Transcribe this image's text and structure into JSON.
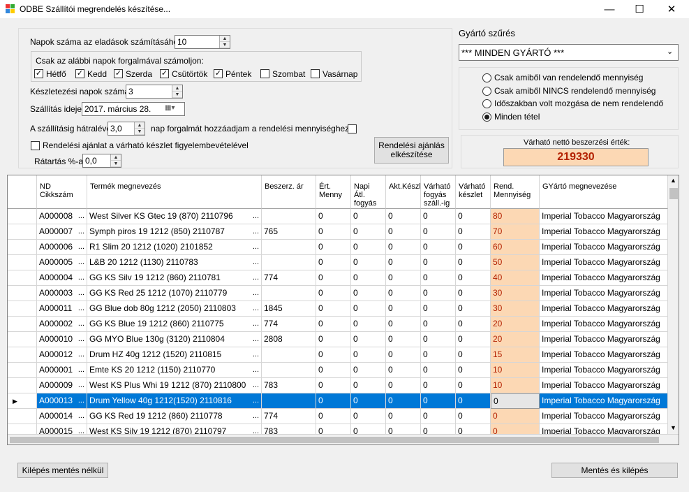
{
  "window": {
    "title": "ODBE Szállítói megrendelés készítése...",
    "minimize": "—",
    "maximize": "☐",
    "close": "✕"
  },
  "settings": {
    "days_label": "Napok száma az eladások számításához:",
    "days_value": "10",
    "weekdays_group_label": "Csak az alábbi napok forgalmával számoljon:",
    "weekdays": [
      {
        "label": "Hétfő",
        "checked": true
      },
      {
        "label": "Kedd",
        "checked": true
      },
      {
        "label": "Szerda",
        "checked": true
      },
      {
        "label": "Csütörtök",
        "checked": true
      },
      {
        "label": "Péntek",
        "checked": true
      },
      {
        "label": "Szombat",
        "checked": false
      },
      {
        "label": "Vasárnap",
        "checked": false
      }
    ],
    "stock_days_label": "Készletezési napok száma",
    "stock_days_value": "3",
    "delivery_label": "Szállítás ideje:",
    "delivery_date": "2017.   március   28.",
    "remaining_label": "A szállításig hátralévő",
    "remaining_value": "3,0",
    "remaining_suffix": "nap forgalmát hozzáadjam a rendelési mennyiséghez?",
    "consider_stock_label": "Rendelési ajánlat a várható készlet figyelembevételével",
    "margin_label": "Rátartás %-a",
    "margin_value": "0,0",
    "make_offer_button": "Rendelési ajánlás elkészítése"
  },
  "filter": {
    "title": "Gyártó szűrés",
    "manufacturer_selected": "*** MINDEN GYÁRTÓ ***",
    "options": [
      {
        "label": "Csak amiből van rendelendő mennyiség",
        "selected": false
      },
      {
        "label": "Csak amiből NINCS rendelendő mennyiség",
        "selected": false
      },
      {
        "label": "Időszakban volt mozgása de nem rendelendő",
        "selected": false
      },
      {
        "label": "Minden tétel",
        "selected": true
      }
    ],
    "expected_value_label": "Várható nettó beszerzési érték:",
    "expected_value": "219330"
  },
  "grid": {
    "headers": {
      "code": "ND Cikkszám",
      "name": "Termék megnevezés",
      "price": "Beszerz. ár",
      "sales": "Ért. Menny",
      "daily": "Napi Átl. fogyás",
      "stock": "Akt.Készl",
      "exp_sales": "Várható fogyás száll.-ig",
      "exp_stock": "Várható készlet",
      "order": "Rend. Mennyiség",
      "manufacturer": "GYártó megnevezése"
    },
    "rows": [
      {
        "code": "A000008",
        "name": "West Silver KS Gtec 19 (870) 2110796",
        "price": "",
        "sales": "0",
        "daily": "0",
        "stock": "0",
        "exp_sales": "0",
        "exp_stock": "0",
        "order": "80",
        "manufacturer": "Imperial Tobacco Magyarország"
      },
      {
        "code": "A000007",
        "name": "Symph piros 19 1212 (850) 2110787",
        "price": "765",
        "sales": "0",
        "daily": "0",
        "stock": "0",
        "exp_sales": "0",
        "exp_stock": "0",
        "order": "70",
        "manufacturer": "Imperial Tobacco Magyarország"
      },
      {
        "code": "A000006",
        "name": "R1 Slim 20 1212 (1020) 2101852",
        "price": "",
        "sales": "0",
        "daily": "0",
        "stock": "0",
        "exp_sales": "0",
        "exp_stock": "0",
        "order": "60",
        "manufacturer": "Imperial Tobacco Magyarország"
      },
      {
        "code": "A000005",
        "name": "L&B 20 1212 (1130) 2110783",
        "price": "",
        "sales": "0",
        "daily": "0",
        "stock": "0",
        "exp_sales": "0",
        "exp_stock": "0",
        "order": "50",
        "manufacturer": "Imperial Tobacco Magyarország"
      },
      {
        "code": "A000004",
        "name": "GG KS Silv 19 1212 (860) 2110781",
        "price": "774",
        "sales": "0",
        "daily": "0",
        "stock": "0",
        "exp_sales": "0",
        "exp_stock": "0",
        "order": "40",
        "manufacturer": "Imperial Tobacco Magyarország"
      },
      {
        "code": "A000003",
        "name": "GG KS Red 25 1212 (1070) 2110779",
        "price": "",
        "sales": "0",
        "daily": "0",
        "stock": "0",
        "exp_sales": "0",
        "exp_stock": "0",
        "order": "30",
        "manufacturer": "Imperial Tobacco Magyarország"
      },
      {
        "code": "A000011",
        "name": "GG Blue dob 80g 1212 (2050) 2110803",
        "price": "1845",
        "sales": "0",
        "daily": "0",
        "stock": "0",
        "exp_sales": "0",
        "exp_stock": "0",
        "order": "30",
        "manufacturer": "Imperial Tobacco Magyarország"
      },
      {
        "code": "A000002",
        "name": "GG KS Blue 19 1212 (860) 2110775",
        "price": "774",
        "sales": "0",
        "daily": "0",
        "stock": "0",
        "exp_sales": "0",
        "exp_stock": "0",
        "order": "20",
        "manufacturer": "Imperial Tobacco Magyarország"
      },
      {
        "code": "A000010",
        "name": "GG MYO Blue 130g (3120) 2110804",
        "price": "2808",
        "sales": "0",
        "daily": "0",
        "stock": "0",
        "exp_sales": "0",
        "exp_stock": "0",
        "order": "20",
        "manufacturer": "Imperial Tobacco Magyarország"
      },
      {
        "code": "A000012",
        "name": "Drum HZ 40g 1212 (1520) 2110815",
        "price": "",
        "sales": "0",
        "daily": "0",
        "stock": "0",
        "exp_sales": "0",
        "exp_stock": "0",
        "order": "15",
        "manufacturer": "Imperial Tobacco Magyarország"
      },
      {
        "code": "A000001",
        "name": "Emte KS 20 1212 (1150) 2110770",
        "price": "",
        "sales": "0",
        "daily": "0",
        "stock": "0",
        "exp_sales": "0",
        "exp_stock": "0",
        "order": "10",
        "manufacturer": "Imperial Tobacco Magyarország"
      },
      {
        "code": "A000009",
        "name": "West KS Plus Whi 19 1212 (870) 2110800",
        "price": "783",
        "sales": "0",
        "daily": "0",
        "stock": "0",
        "exp_sales": "0",
        "exp_stock": "0",
        "order": "10",
        "manufacturer": "Imperial Tobacco Magyarország"
      },
      {
        "code": "A000013",
        "name": "Drum Yellow 40g 1212(1520) 2110816",
        "price": "",
        "sales": "0",
        "daily": "0",
        "stock": "0",
        "exp_sales": "0",
        "exp_stock": "0",
        "order": "0",
        "manufacturer": "Imperial Tobacco Magyarország",
        "selected": true
      },
      {
        "code": "A000014",
        "name": "GG KS Red 19 1212 (860) 2110778",
        "price": "774",
        "sales": "0",
        "daily": "0",
        "stock": "0",
        "exp_sales": "0",
        "exp_stock": "0",
        "order": "0",
        "manufacturer": "Imperial Tobacco Magyarország"
      },
      {
        "code": "A000015",
        "name": "West KS Silv 19 1212 (870) 2110797",
        "price": "783",
        "sales": "0",
        "daily": "0",
        "stock": "0",
        "exp_sales": "0",
        "exp_stock": "0",
        "order": "0",
        "manufacturer": "Imperial Tobacco Magyarország"
      }
    ]
  },
  "footer": {
    "exit_no_save": "Kilépés mentés nélkül",
    "save_exit": "Mentés és kilépés"
  },
  "colors": {
    "order_cell_bg": "#fcd8b4",
    "order_cell_text": "#b32000",
    "selection": "#0078d7"
  }
}
